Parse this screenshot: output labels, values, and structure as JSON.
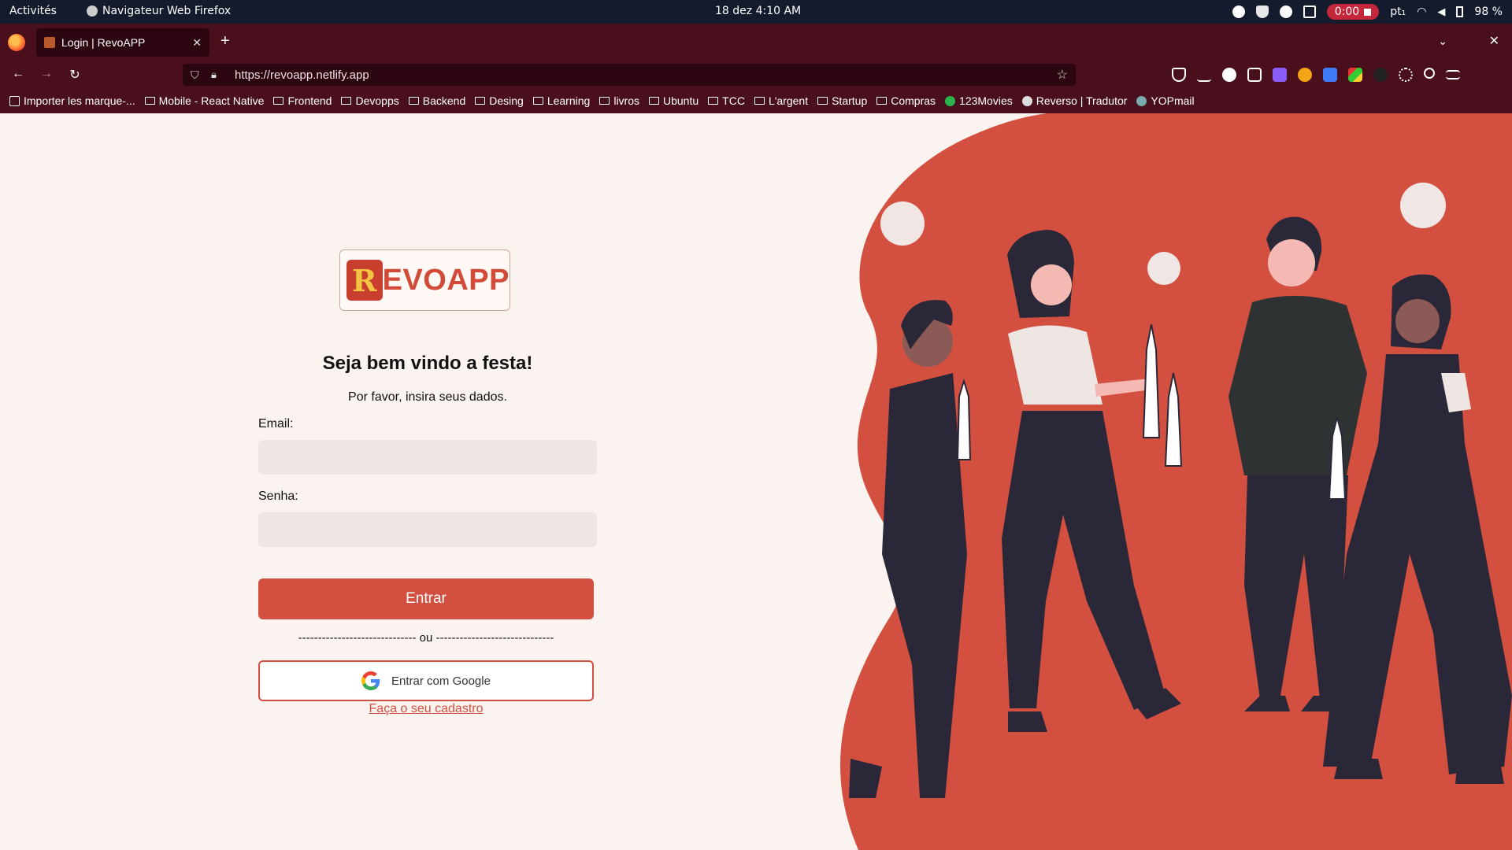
{
  "system_bar": {
    "activities": "Activités",
    "app_name": "Navigateur Web Firefox",
    "clock": "18 dez  4:10 AM",
    "recording_time": "0:00",
    "language": "pt₁",
    "battery": "98 %"
  },
  "browser": {
    "tab_title": "Login | RevoAPP",
    "url": "https://revoapp.netlify.app",
    "bookmarks": [
      {
        "label": "Importer les marque-...",
        "icon": "import-icon"
      },
      {
        "label": "Mobile - React Native",
        "icon": "folder-icon"
      },
      {
        "label": "Frontend",
        "icon": "folder-icon"
      },
      {
        "label": "Devopps",
        "icon": "folder-icon"
      },
      {
        "label": "Backend",
        "icon": "folder-icon"
      },
      {
        "label": "Desing",
        "icon": "folder-icon"
      },
      {
        "label": "Learning",
        "icon": "folder-icon"
      },
      {
        "label": "livros",
        "icon": "folder-icon"
      },
      {
        "label": "Ubuntu",
        "icon": "folder-icon"
      },
      {
        "label": "TCC",
        "icon": "folder-icon"
      },
      {
        "label": "L'argent",
        "icon": "folder-icon"
      },
      {
        "label": "Startup",
        "icon": "folder-icon"
      },
      {
        "label": "Compras",
        "icon": "folder-icon"
      },
      {
        "label": "123Movies",
        "icon": "play-icon"
      },
      {
        "label": "Reverso | Tradutor",
        "icon": "reverso-icon"
      },
      {
        "label": "YOPmail",
        "icon": "yopmail-icon"
      }
    ]
  },
  "login": {
    "logo_text": "EVOAPP",
    "logo_letter": "R",
    "title": "Seja bem vindo a festa!",
    "subtitle": "Por favor, insira seus dados.",
    "email_label": "Email:",
    "password_label": "Senha:",
    "email_value": "",
    "password_value": "",
    "enter_button": "Entrar",
    "divider": "------------------------------ ou ------------------------------",
    "google_button": "Entrar com Google",
    "signup_link": "Faça o seu cadastro"
  },
  "colors": {
    "accent": "#d35040",
    "browser_chrome": "#4a0f1c",
    "page_bg": "#fbf3ef",
    "figure_dark": "#2a2838"
  }
}
